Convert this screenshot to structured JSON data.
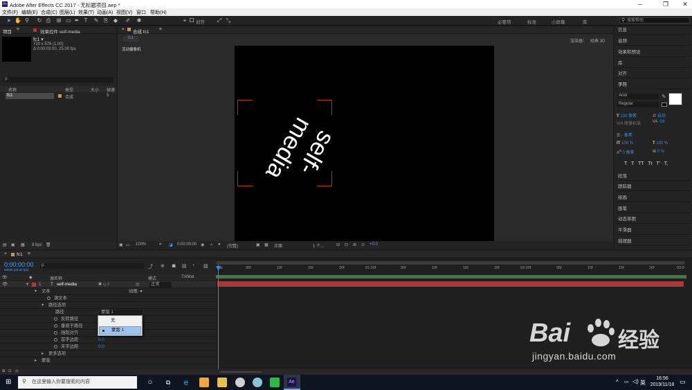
{
  "window": {
    "title": "Adobe After Effects CC 2017 - 无标题项目.aep *",
    "minimize": "─",
    "maximize": "❐",
    "close": "✕"
  },
  "menu": [
    "文件(F)",
    "编辑(E)",
    "合成(C)",
    "图层(L)",
    "效果(T)",
    "动画(A)",
    "视图(V)",
    "窗口",
    "帮助(H)"
  ],
  "toolbar": {
    "align": "对齐",
    "workspaces": [
      "必要项",
      "标准",
      "小屏幕",
      "库"
    ],
    "search_placeholder": "搜索帮助"
  },
  "project_panel": {
    "tab": "项目",
    "effects_tab": "效果控件 self-media",
    "item_name": "fc1 ▾",
    "item_dims": "720 x 576 (1.00)",
    "item_dur": "Δ 0:00:03:00, 25.00 fps",
    "search_placeholder": "ρ.",
    "columns": {
      "name": "名称",
      "type": "类型",
      "size": "大小",
      "dur": "帧速"
    },
    "rows": [
      {
        "name": "fc1",
        "type": "合成",
        "dur": "5"
      }
    ],
    "footer_bpc": "8 bpc"
  },
  "comp_panel": {
    "tab": "合成 fc1",
    "breadcrumb": "fc1",
    "renderer_label": "渲染器：",
    "renderer": "经典 3D",
    "view_label": "活动摄像机",
    "text_top": "self-",
    "text_bottom": "media",
    "footer": {
      "zoom": "100%",
      "timecode": "0:00:00:00",
      "channel": "(完整)",
      "view": "正面",
      "views": "1 个...",
      "exposure": "+0.0"
    }
  },
  "right_panels": {
    "items": [
      "信息",
      "音频",
      "效果和预设",
      "库",
      "对齐"
    ],
    "char_title": "字符",
    "font": "Arial",
    "style": "Regular",
    "size": "100 像素",
    "leading": "自动",
    "tracking_label": "度量标准",
    "tracking": "-56",
    "indent": "- 像素",
    "hscale": "100 %",
    "vscale": "100 %",
    "baseline": "0 像素",
    "tsume": "0 %",
    "type_buttons": [
      "T",
      "T",
      "TT",
      "Tt",
      "T'",
      "T,"
    ],
    "bottom_items": [
      "段落",
      "跟踪器",
      "绘画",
      "画笔",
      "动态草图",
      "平滑器",
      "摇摆器"
    ]
  },
  "timeline": {
    "tab": "fc1",
    "timecode": "0:00:00:00",
    "timecode_sub": "00000 (25.00 fps)",
    "search_placeholder": "ρ.",
    "columns": {
      "source": "源名称",
      "mode": "模式",
      "trkmat": "TrkMat"
    },
    "layer": {
      "index": "1",
      "type": "T",
      "name": "self-media",
      "mode": "正常"
    },
    "rows": [
      {
        "label": "文本",
        "anim": "动画: ●"
      },
      {
        "label": "源文本"
      },
      {
        "label": "路径选项"
      },
      {
        "label": "路径",
        "value": "蒙版 1"
      },
      {
        "label": "反转路径"
      },
      {
        "label": "垂直于路径"
      },
      {
        "label": "强制对齐"
      },
      {
        "label": "首字边距",
        "value": "0.0"
      },
      {
        "label": "末字边距",
        "value": "0.0"
      },
      {
        "label": "更多选项"
      },
      {
        "label": "蒙版"
      }
    ],
    "dropdown": {
      "options": [
        "无",
        "蒙版 1"
      ],
      "selected": "蒙版 1"
    },
    "ruler": [
      "0s",
      "05f",
      "10f",
      "15f",
      "20f",
      "01:00f",
      "05f",
      "10f",
      "15f",
      "20f",
      "02:00f",
      "05f",
      "10f",
      "15f",
      "20f",
      "03:0"
    ]
  },
  "watermark": {
    "brand": "Bai",
    "brand2": "经验",
    "url": "jingyan.baidu.com"
  },
  "taskbar": {
    "search": "在这里输入你要搜索的内容",
    "time": "16:56",
    "date": "2019/11/18",
    "ime": "英"
  }
}
